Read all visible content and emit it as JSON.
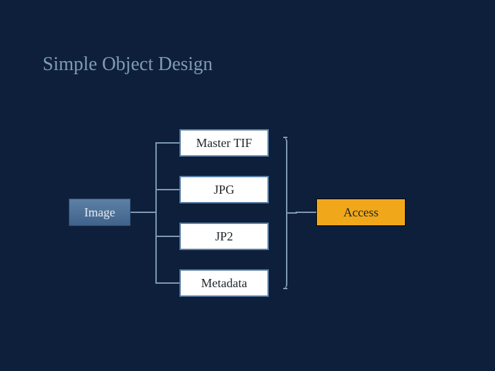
{
  "title": "Simple Object Design",
  "nodes": {
    "root": "Image",
    "children": [
      "Master TIF",
      "JPG",
      "JP2",
      "Metadata"
    ],
    "right": "Access"
  }
}
